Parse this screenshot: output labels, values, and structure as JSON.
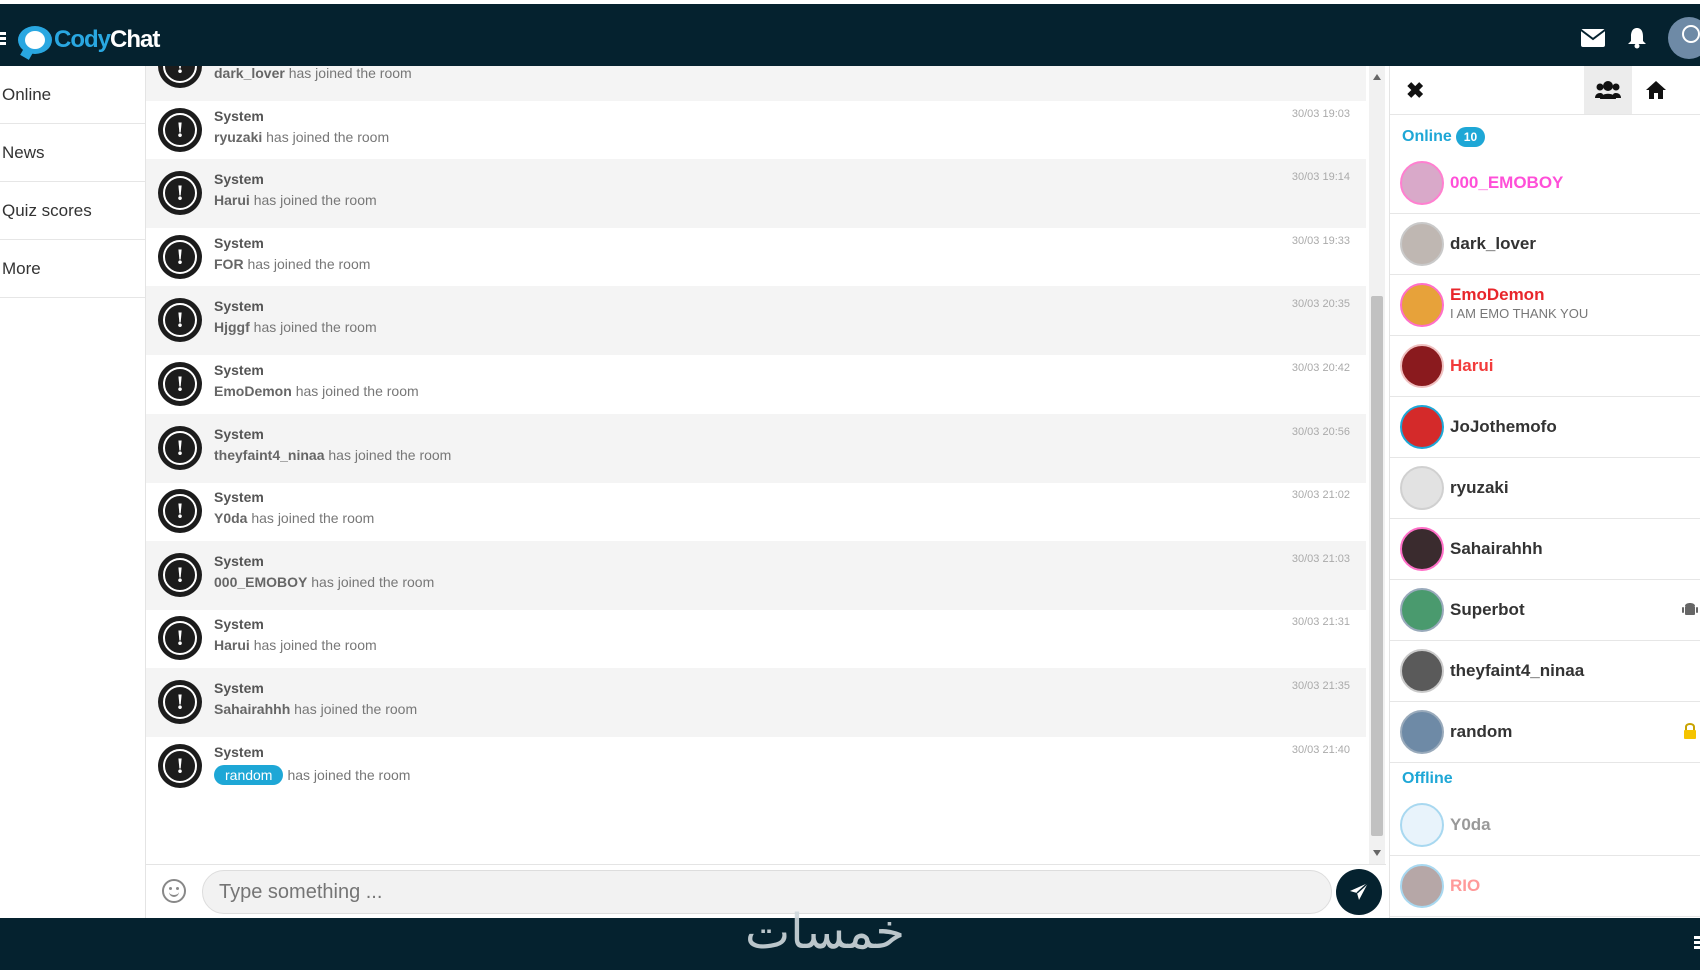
{
  "app": {
    "logo_part1": "Cody",
    "logo_part2": "Chat"
  },
  "leftnav": {
    "items": [
      "Online",
      "News",
      "Quiz scores",
      "More"
    ]
  },
  "messages": [
    {
      "sender": "System",
      "user": "dark_lover",
      "text": "has joined the room",
      "time": ""
    },
    {
      "sender": "System",
      "user": "ryuzaki",
      "text": "has joined the room",
      "time": "30/03 19:03"
    },
    {
      "sender": "System",
      "user": "Harui",
      "text": "has joined the room",
      "time": "30/03 19:14"
    },
    {
      "sender": "System",
      "user": "FOR",
      "text": "has joined the room",
      "time": "30/03 19:33"
    },
    {
      "sender": "System",
      "user": "Hjggf",
      "text": "has joined the room",
      "time": "30/03 20:35"
    },
    {
      "sender": "System",
      "user": "EmoDemon",
      "text": "has joined the room",
      "time": "30/03 20:42"
    },
    {
      "sender": "System",
      "user": "theyfaint4_ninaa",
      "text": "has joined the room",
      "time": "30/03 20:56"
    },
    {
      "sender": "System",
      "user": "Y0da",
      "text": "has joined the room",
      "time": "30/03 21:02"
    },
    {
      "sender": "System",
      "user": "000_EMOBOY",
      "text": "has joined the room",
      "time": "30/03 21:03"
    },
    {
      "sender": "System",
      "user": "Harui",
      "text": "has joined the room",
      "time": "30/03 21:31"
    },
    {
      "sender": "System",
      "user": "Sahairahhh",
      "text": "has joined the room",
      "time": "30/03 21:35"
    },
    {
      "sender": "System",
      "user": "random",
      "text": "has joined the room",
      "time": "30/03 21:40",
      "pill": true
    }
  ],
  "composer": {
    "placeholder": "Type something ..."
  },
  "userlist": {
    "online_title": "Online",
    "online_count": "10",
    "offline_title": "Offline",
    "online": [
      {
        "name": "000_EMOBOY",
        "color": "#ff4fd8",
        "avatar": "#d9a9c9",
        "border": "#ff7fd0"
      },
      {
        "name": "dark_lover",
        "color": "#333333",
        "avatar": "#bfb7b2",
        "border": "#c9c9c9"
      },
      {
        "name": "EmoDemon",
        "color": "#e8262b",
        "mood": "I AM EMO THANK YOU",
        "avatar": "#e7a23a",
        "border": "#ff6ec7"
      },
      {
        "name": "Harui",
        "color": "#f23b3b",
        "avatar": "#8a1a1e",
        "border": "#f0c0c0"
      },
      {
        "name": "JoJothemofo",
        "color": "#333333",
        "avatar": "#d42a2a",
        "border": "#1ea7d6"
      },
      {
        "name": "ryuzaki",
        "color": "#333333",
        "avatar": "#e2e2e2",
        "border": "#d0d0d0"
      },
      {
        "name": "Sahairahhh",
        "color": "#333333",
        "avatar": "#3a2b2e",
        "border": "#ff6ec7"
      },
      {
        "name": "Superbot",
        "color": "#333333",
        "avatar": "#4a9a6e",
        "border": "#9ab",
        "badge": "android-icon"
      },
      {
        "name": "theyfaint4_ninaa",
        "color": "#333333",
        "avatar": "#5a5a5a",
        "border": "#c9c9c9"
      },
      {
        "name": "random",
        "color": "#333333",
        "avatar": "#6e8aa6",
        "border": "#9ab",
        "badge": "lock-icon"
      }
    ],
    "offline": [
      {
        "name": "Y0da",
        "color": "#999999",
        "avatar": "#e8f3fb",
        "border": "#a8d8f0"
      },
      {
        "name": "RIO",
        "color": "#ff9a9a",
        "avatar": "#b6a7a7",
        "border": "#a8d8f0"
      }
    ]
  },
  "footer": {
    "watermark": "خمسات"
  },
  "colors": {
    "topbar": "#05222f",
    "accent": "#1ea7d6"
  }
}
